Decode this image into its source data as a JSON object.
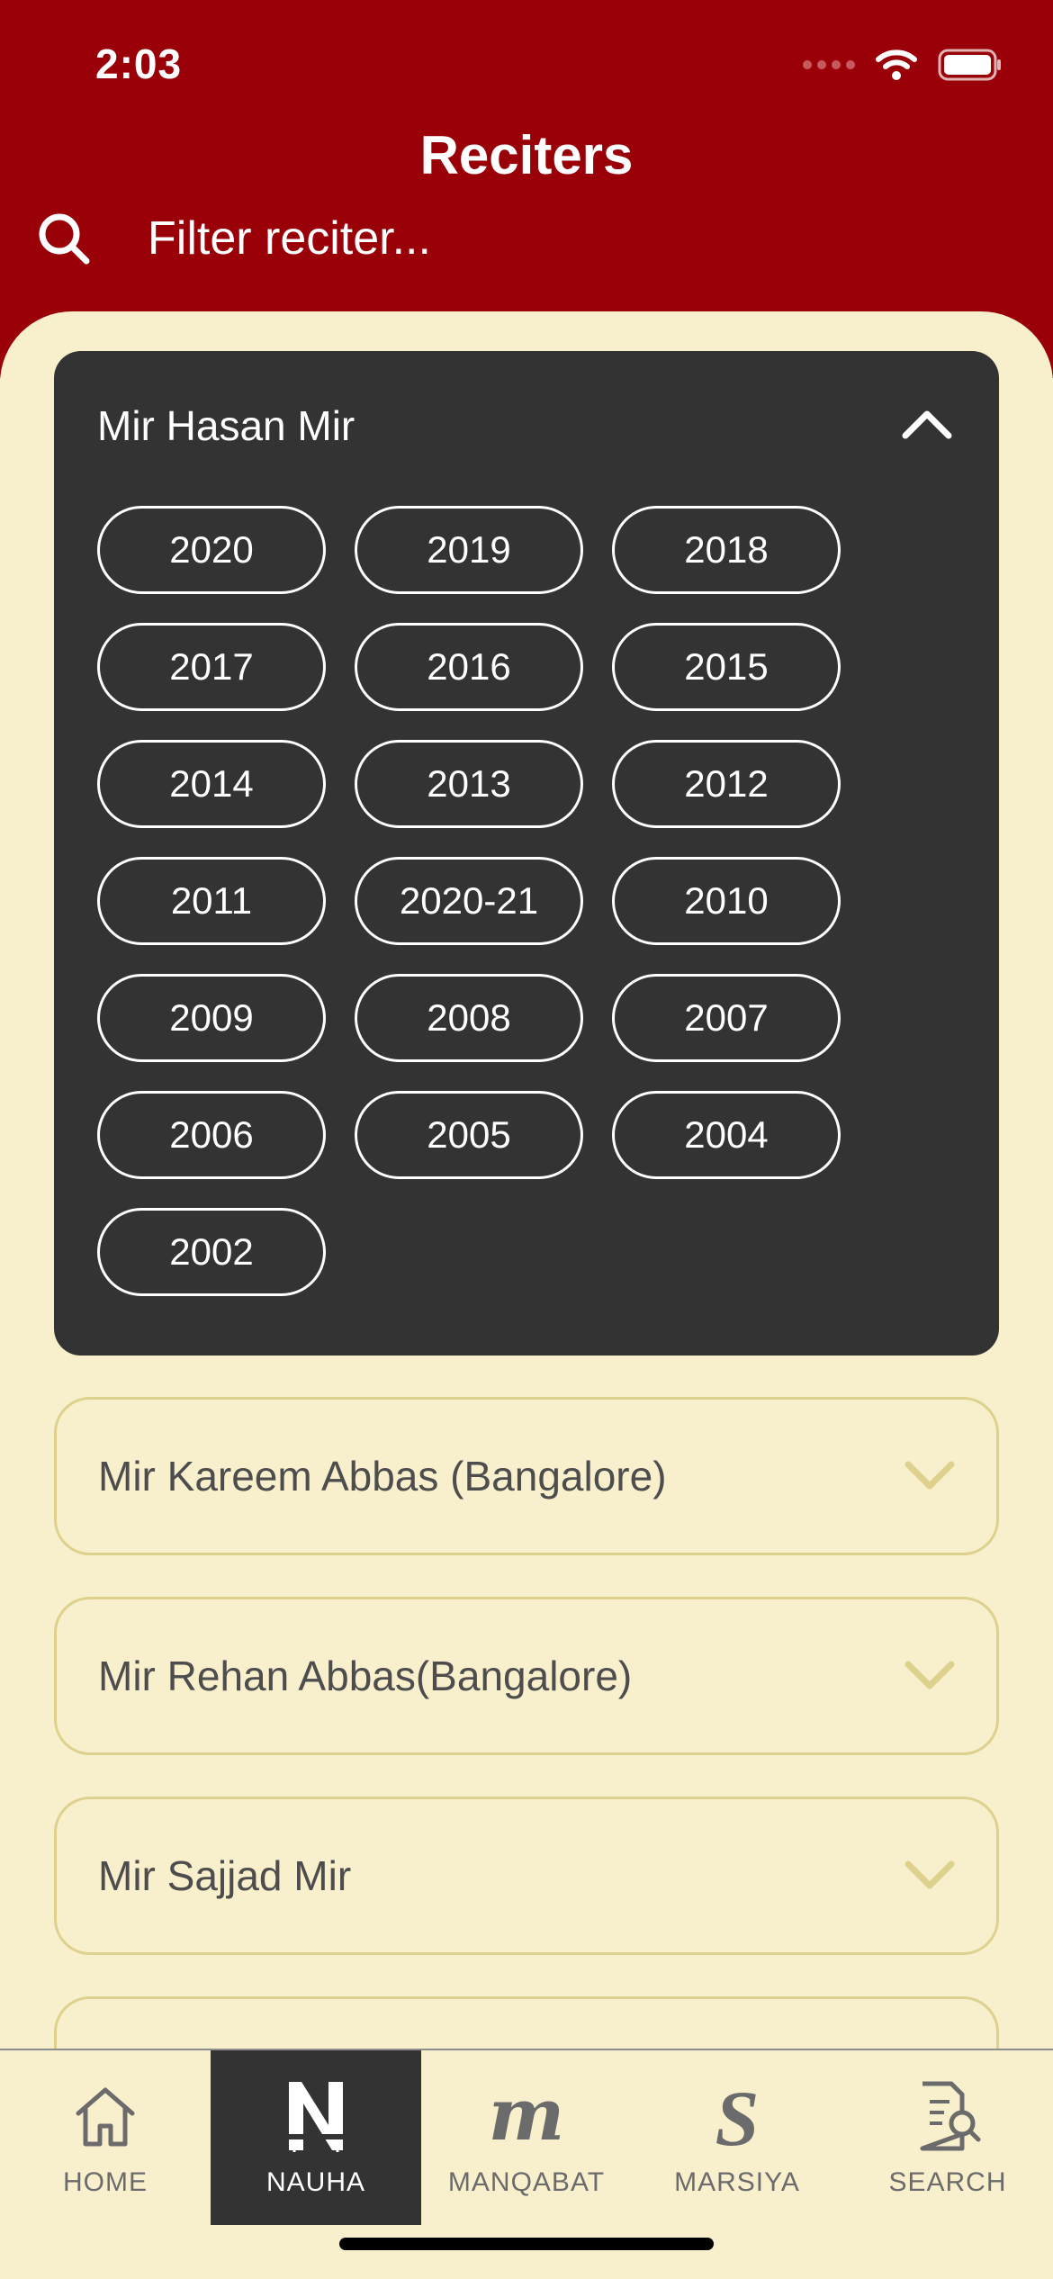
{
  "status_bar": {
    "time": "2:03"
  },
  "header": {
    "title": "Reciters",
    "search_placeholder": "Filter reciter..."
  },
  "expanded_reciter": {
    "name": "Mir Hasan Mir",
    "years": [
      "2020",
      "2019",
      "2018",
      "2017",
      "2016",
      "2015",
      "2014",
      "2013",
      "2012",
      "2011",
      "2020-21",
      "2010",
      "2009",
      "2008",
      "2007",
      "2006",
      "2005",
      "2004",
      "2002"
    ]
  },
  "reciters": [
    {
      "name": "Mir Kareem Abbas (Bangalore)"
    },
    {
      "name": "Mir Rehan Abbas(Bangalore)"
    },
    {
      "name": "Mir Sajjad Mir"
    }
  ],
  "bottom_nav": {
    "items": [
      {
        "label": "HOME",
        "icon": "home-icon"
      },
      {
        "label": "NAUHA",
        "icon": "nauha-icon",
        "active": true
      },
      {
        "label": "MANQABAT",
        "icon": "manqabat-icon"
      },
      {
        "label": "MARSIYA",
        "icon": "marsiya-icon"
      },
      {
        "label": "SEARCH",
        "icon": "search-document-icon"
      }
    ]
  },
  "colors": {
    "header": "#990008",
    "background": "#f8efcc",
    "card_dark": "#333333",
    "card_border": "#ddd18d"
  }
}
